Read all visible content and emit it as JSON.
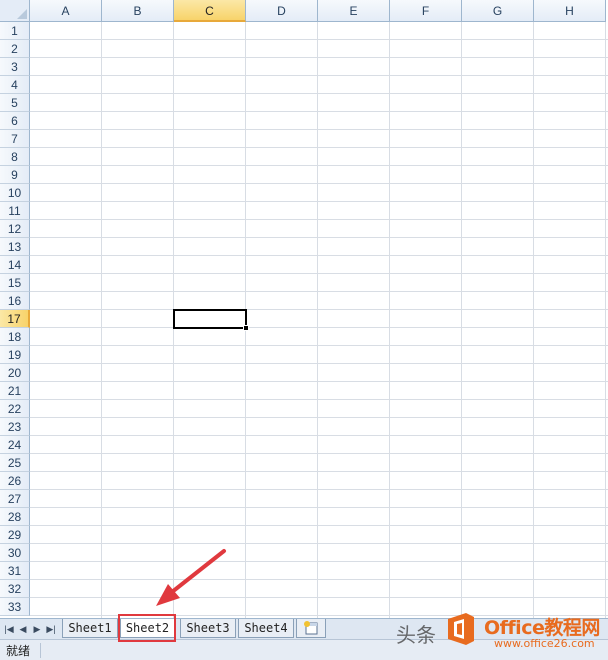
{
  "grid": {
    "columns": [
      "A",
      "B",
      "C",
      "D",
      "E",
      "F",
      "G",
      "H"
    ],
    "selected_column": "C",
    "rows": [
      "1",
      "2",
      "3",
      "4",
      "5",
      "6",
      "7",
      "8",
      "9",
      "10",
      "11",
      "12",
      "13",
      "14",
      "15",
      "16",
      "17",
      "18",
      "19",
      "20",
      "21",
      "22",
      "23",
      "24",
      "25",
      "26",
      "27",
      "28",
      "29",
      "30",
      "31",
      "32",
      "33"
    ],
    "selected_row": "17",
    "active_cell": "C17"
  },
  "tabbar": {
    "nav_icons": [
      "first-sheet-icon",
      "prev-sheet-icon",
      "next-sheet-icon",
      "last-sheet-icon"
    ],
    "sheets": [
      "Sheet1",
      "Sheet2",
      "Sheet3",
      "Sheet4"
    ],
    "active_sheet": "Sheet2",
    "new_sheet_icon": "insert-sheet-icon"
  },
  "statusbar": {
    "status": "就绪"
  },
  "annotation": {
    "highlight_color": "#e0393e",
    "arrow_color": "#e0393e"
  },
  "watermark": {
    "toutiao": "头条",
    "brand": "Office教程网",
    "url": "www.office26.com",
    "brand_color": "#e86b1f"
  }
}
